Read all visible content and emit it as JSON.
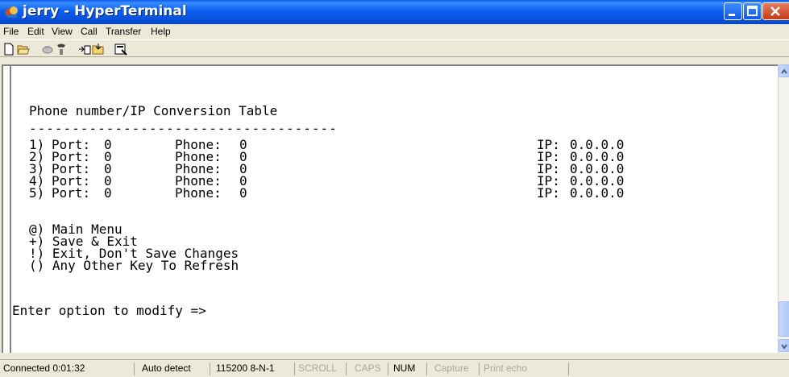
{
  "window": {
    "title": "jerry - HyperTerminal",
    "controls": [
      "minimize",
      "maximize",
      "close"
    ]
  },
  "menu": {
    "items": [
      "File",
      "Edit",
      "View",
      "Call",
      "Transfer",
      "Help"
    ]
  },
  "toolbar": {
    "icons": [
      "new-document-icon",
      "open-folder-icon",
      "connect-phone-icon",
      "disconnect-phone-icon",
      "send-file-icon",
      "receive-file-icon",
      "properties-icon"
    ]
  },
  "terminal": {
    "heading": "Phone number/IP Conversion Table",
    "separator": "------------------------------------",
    "rows": [
      {
        "index": "1)",
        "port_label": "Port:",
        "port": "0",
        "phone_label": "Phone:",
        "phone": "0",
        "ip_label": "IP:",
        "ip": "0.0.0.0"
      },
      {
        "index": "2)",
        "port_label": "Port:",
        "port": "0",
        "phone_label": "Phone:",
        "phone": "0",
        "ip_label": "IP:",
        "ip": "0.0.0.0"
      },
      {
        "index": "3)",
        "port_label": "Port:",
        "port": "0",
        "phone_label": "Phone:",
        "phone": "0",
        "ip_label": "IP:",
        "ip": "0.0.0.0"
      },
      {
        "index": "4)",
        "port_label": "Port:",
        "port": "0",
        "phone_label": "Phone:",
        "phone": "0",
        "ip_label": "IP:",
        "ip": "0.0.0.0"
      },
      {
        "index": "5)",
        "port_label": "Port:",
        "port": "0",
        "phone_label": "Phone:",
        "phone": "0",
        "ip_label": "IP:",
        "ip": "0.0.0.0"
      }
    ],
    "options": [
      "@) Main Menu",
      "+) Save & Exit",
      "!) Exit, Don't Save Changes",
      "() Any Other Key To Refresh"
    ],
    "prompt": "Enter option to modify =>"
  },
  "status": {
    "connected": "Connected 0:01:32",
    "detect": "Auto detect",
    "settings": "115200 8-N-1",
    "scroll": "SCROLL",
    "caps": "CAPS",
    "num": "NUM",
    "capture": "Capture",
    "print_echo": "Print echo"
  },
  "colors": {
    "title_bar": "#0a5ce8",
    "close_button": "#c63a18",
    "terminal_bg": "#ffffff",
    "chrome": "#ece9d8"
  }
}
